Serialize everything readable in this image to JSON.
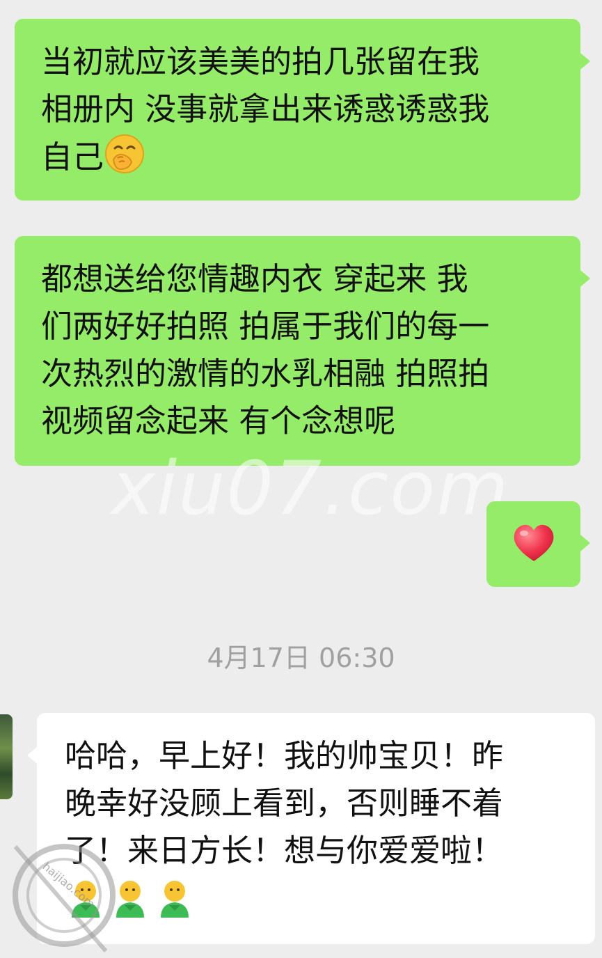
{
  "messages": [
    {
      "side": "sent",
      "text": "当初就应该美美的拍几张留在我\n相册内 没事就拿出来诱惑诱惑我\n自己",
      "trailing_emoji": "hand-over-mouth-emoji"
    },
    {
      "side": "sent",
      "text": "都想送给您情趣内衣 穿起来 我\n们两好好拍照 拍属于我们的每一\n次热烈的激情的水乳相融 拍照拍\n视频留念起来 有个念想呢"
    },
    {
      "side": "sent",
      "emoji": "red-heart-emoji"
    },
    {
      "side": "received",
      "text": "哈哈，早上好！我的帅宝贝！昨\n晚幸好没顾上看到，否则睡不着\n了！来日方长！想与你爱爱啦！",
      "trailing_emojis": [
        "person-emoji",
        "person-emoji",
        "person-emoji"
      ]
    }
  ],
  "timestamp": "4月17日 06:30",
  "watermark": "xiu07.com",
  "stamp_text": "haijiao.com",
  "colors": {
    "sent_bubble": "#95ec69",
    "received_bubble": "#ffffff",
    "background": "#ededed",
    "timestamp": "#a0a0a0"
  }
}
